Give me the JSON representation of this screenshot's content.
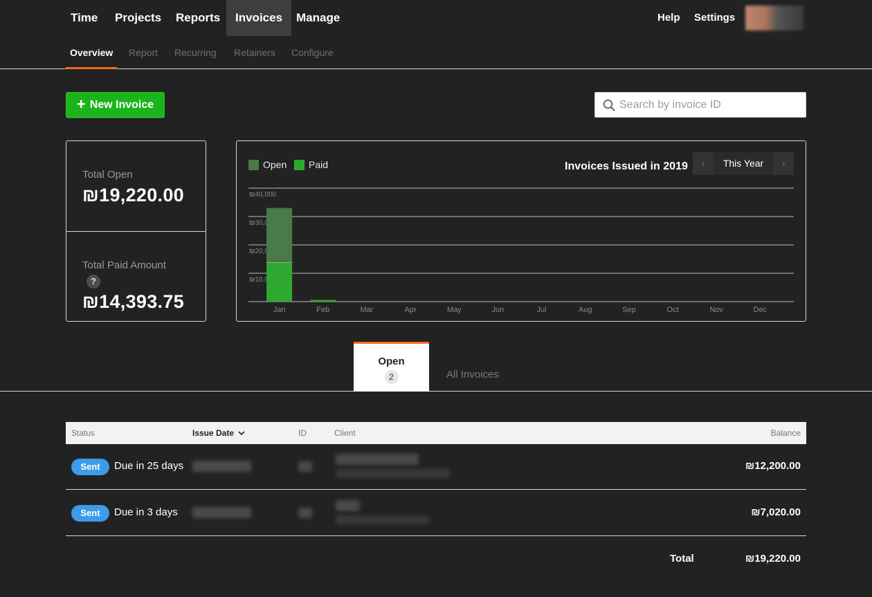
{
  "nav": {
    "items": [
      {
        "label": "Time"
      },
      {
        "label": "Projects"
      },
      {
        "label": "Reports"
      },
      {
        "label": "Invoices"
      },
      {
        "label": "Manage"
      }
    ],
    "help_label": "Help",
    "settings_label": "Settings"
  },
  "subnav": {
    "items": [
      {
        "label": "Overview"
      },
      {
        "label": "Report"
      },
      {
        "label": "Recurring"
      },
      {
        "label": "Retainers"
      },
      {
        "label": "Configure"
      }
    ]
  },
  "actions": {
    "new_invoice_plus": "+",
    "new_invoice_label": "New Invoice",
    "search_placeholder": "Search by invoice ID"
  },
  "summary": {
    "total_open_label": "Total Open",
    "total_open_value": "₪19,220.00",
    "total_paid_label": "Total Paid Amount",
    "help_icon_text": "?",
    "total_paid_value": "₪14,393.75"
  },
  "chart_panel": {
    "prev_arrow": "‹",
    "next_arrow": "›",
    "period_label": "This Year"
  },
  "chart_data": {
    "type": "bar",
    "stacked": true,
    "title": "Invoices Issued in 2019",
    "categories": [
      "Jan",
      "Feb",
      "Mar",
      "Apr",
      "May",
      "Jun",
      "Jul",
      "Aug",
      "Sep",
      "Oct",
      "Nov",
      "Dec"
    ],
    "series": [
      {
        "name": "Paid",
        "color": "#2fa82f",
        "values": [
          13800,
          600,
          0,
          0,
          0,
          0,
          0,
          0,
          0,
          0,
          0,
          0
        ]
      },
      {
        "name": "Open",
        "color": "#4a7a48",
        "values": [
          19220,
          0,
          0,
          0,
          0,
          0,
          0,
          0,
          0,
          0,
          0,
          0
        ]
      }
    ],
    "y_ticks": [
      "₪10,000",
      "₪20,000",
      "₪30,000",
      "₪40,000"
    ],
    "ylim": [
      0,
      40000
    ],
    "grid": true,
    "legend": "top-left"
  },
  "tabs": {
    "open_label": "Open",
    "open_count": "2",
    "all_label": "All Invoices"
  },
  "table": {
    "headers": {
      "status": "Status",
      "issue_date": "Issue Date",
      "id": "ID",
      "client": "Client",
      "balance": "Balance"
    },
    "rows": [
      {
        "status": "Sent",
        "due": "Due in 25 days",
        "balance": "₪12,200.00"
      },
      {
        "status": "Sent",
        "due": "Due in 3 days",
        "balance": "₪7,020.00"
      }
    ],
    "total_label": "Total",
    "total_value": "₪19,220.00"
  }
}
